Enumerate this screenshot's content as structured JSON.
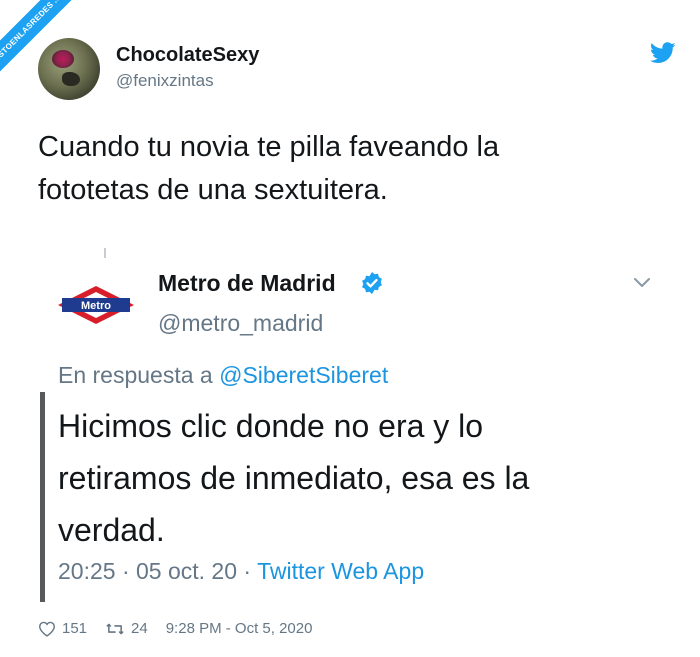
{
  "watermark": "VISTOENLASREDES .com",
  "tweet": {
    "display_name": "ChocolateSexy",
    "handle": "@fenixzintas",
    "text": "Cuando tu novia te pilla faveando la\nfototetas de una sextuitera.",
    "likes": "151",
    "retweets": "24",
    "timestamp": "9:28 PM - Oct 5, 2020"
  },
  "embedded": {
    "display_name": "Metro de Madrid",
    "handle": "@metro_madrid",
    "logo_text": "Metro",
    "reply_prefix": "En respuesta a",
    "reply_mention": "@SiberetSiberet",
    "text": "Hicimos clic donde no era y lo\nretiramos de inmediato, esa es la\nverdad.",
    "time_date": "20:25 · 05 oct. 20 ·",
    "source": "Twitter Web App"
  },
  "icons": {
    "twitter": "bird-icon",
    "verified": "verified-check-icon",
    "chevron": "chevron-down-icon",
    "like": "heart-icon",
    "retweet": "retweet-icon"
  },
  "colors": {
    "twitter_blue": "#1da1f2",
    "link_blue": "#1b95e0",
    "metro_red": "#d81e2a",
    "metro_blue": "#1f3b8f",
    "secondary_text": "#657786"
  }
}
